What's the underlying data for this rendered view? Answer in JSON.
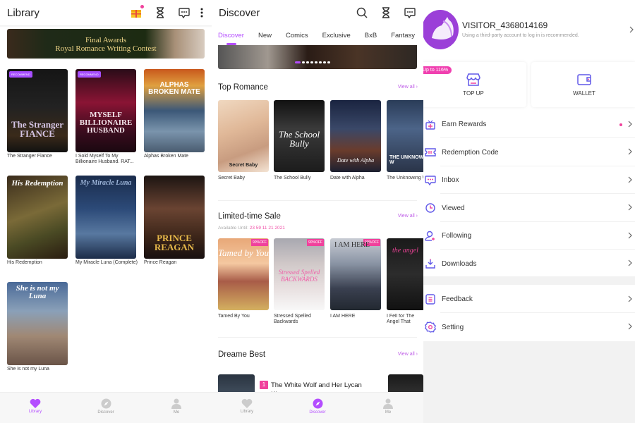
{
  "colors": {
    "accent": "#b44dff",
    "pink": "#f0419c",
    "view_all": "#c060e8"
  },
  "library": {
    "title": "Library",
    "icons": [
      "gift-icon",
      "hourglass-icon",
      "message-icon",
      "more-icon"
    ],
    "banner": {
      "line1": "Final Awards",
      "line2": "Royal Romance Writing Contest"
    },
    "badge_label": "RECOMMEND",
    "books": [
      {
        "title": "The Stranger Fiance",
        "cover_text": "The Stranger FIANCE",
        "badge": true
      },
      {
        "title": "I Sold Myself To My Billionaire Husband. RAT...",
        "cover_text": "MYSELF BILLIONAIRE HUSBAND",
        "badge": true
      },
      {
        "title": "Alphas Broken Mate",
        "cover_text": "ALPHAS BROKEN MATE",
        "badge": false
      },
      {
        "title": "His Redemption",
        "cover_text": "His Redemption",
        "badge": false
      },
      {
        "title": "My Miracle Luna (Complete)",
        "cover_text": "My Miracle Luna",
        "badge": false
      },
      {
        "title": "Prince Reagan",
        "cover_text": "PRINCE REAGAN",
        "badge": false
      },
      {
        "title": "She is not my Luna",
        "cover_text": "She is not my Luna",
        "badge": false
      }
    ]
  },
  "discover": {
    "title": "Discover",
    "icons": [
      "search-icon",
      "hourglass-icon",
      "message-icon"
    ],
    "tabs": [
      "Discover",
      "New",
      "Comics",
      "Exclusive",
      "BxB",
      "Fantasy"
    ],
    "active_tab": "Discover",
    "carousel": {
      "count": 8,
      "active": 1
    },
    "view_all": "View all",
    "top_romance": {
      "heading": "Top Romance",
      "books": [
        {
          "title": "Secret Baby",
          "cover_text": "Secret Baby"
        },
        {
          "title": "The School Bully",
          "cover_text": "The School Bully"
        },
        {
          "title": "Date with Alpha",
          "cover_text": "Date with Alpha"
        },
        {
          "title": "The Unknowing W",
          "cover_text": "THE UNKNOWING W"
        }
      ]
    },
    "sale": {
      "heading": "Limited-time Sale",
      "available_label": "Available Until:",
      "available_value": "23 59 11 21 2021",
      "off_label": "90%OFF",
      "books": [
        {
          "title": "Tamed By You",
          "cover_text": "Tamed by You"
        },
        {
          "title": "Stressed Spelled Backwards",
          "cover_text": "Stressed Spelled BACKWARDS"
        },
        {
          "title": "I AM HERE",
          "cover_text": "I AM HERE"
        },
        {
          "title": "I Fell for The Angel That Killed Me",
          "cover_text": "the angel"
        }
      ]
    },
    "best": {
      "heading": "Dreame Best",
      "rank": "1",
      "first_title": "The White Wolf and Her Lycan King"
    }
  },
  "me": {
    "username": "VISITOR_4368014169",
    "hint": "Using a third-party account to log in is recommended.",
    "promo": "Up to 116%",
    "top_up": "TOP UP",
    "wallet": "WALLET",
    "menu_group1": [
      {
        "label": "Earn Rewards",
        "icon": "gift-box-icon",
        "dot": true
      },
      {
        "label": "Redemption Code",
        "icon": "ticket-icon",
        "dot": false
      },
      {
        "label": "Inbox",
        "icon": "inbox-icon",
        "dot": false
      },
      {
        "label": "Viewed",
        "icon": "clock-icon",
        "dot": false
      },
      {
        "label": "Following",
        "icon": "following-icon",
        "dot": false
      },
      {
        "label": "Downloads",
        "icon": "download-icon",
        "dot": false
      }
    ],
    "menu_group2": [
      {
        "label": "Feedback",
        "icon": "feedback-icon"
      },
      {
        "label": "Setting",
        "icon": "gear-icon"
      }
    ]
  },
  "nav": {
    "library": "Library",
    "discover": "Discover",
    "me": "Me"
  }
}
